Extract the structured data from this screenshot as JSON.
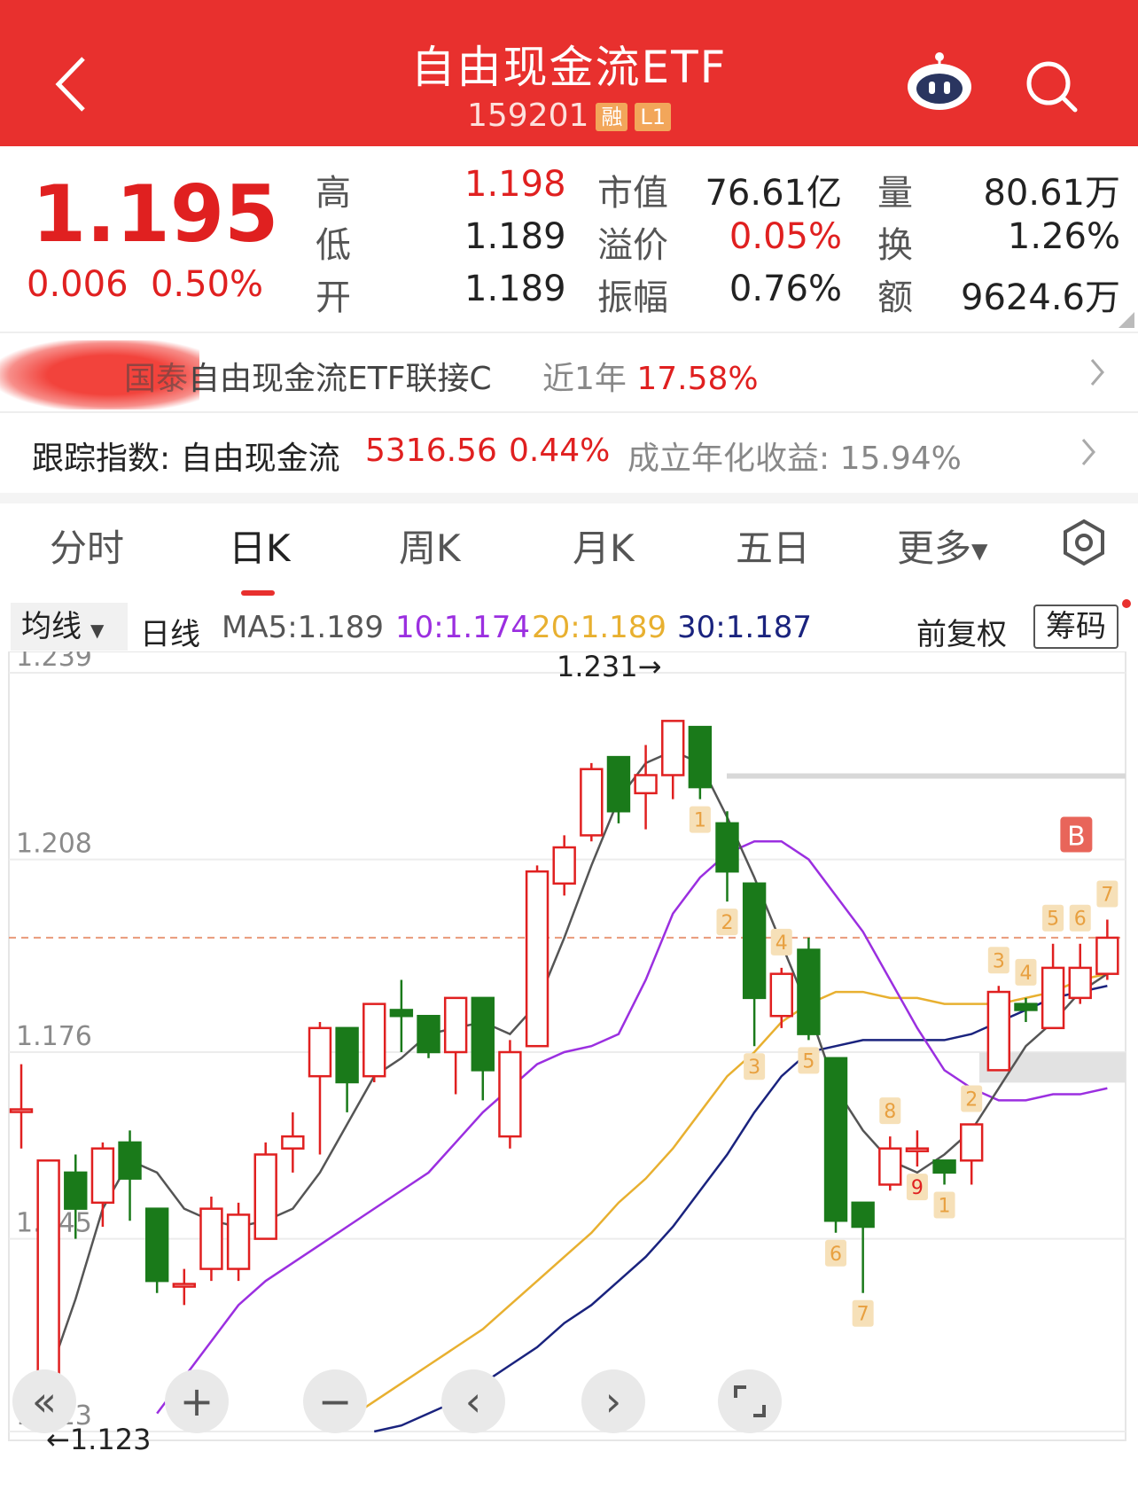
{
  "header": {
    "title": "自由现金流ETF",
    "code": "159201",
    "badge_margin": "融",
    "badge_level": "L1"
  },
  "quote": {
    "price": "1.195",
    "change": "0.006",
    "change_pct": "0.50%",
    "high_label": "高",
    "high": "1.198",
    "low_label": "低",
    "low": "1.189",
    "open_label": "开",
    "open": "1.189",
    "mcap_label": "市值",
    "mcap": "76.61亿",
    "premium_label": "溢价",
    "premium": "0.05%",
    "amp_label": "振幅",
    "amp": "0.76%",
    "vol_label": "量",
    "vol": "80.61万",
    "turn_label": "换",
    "turn": "1.26%",
    "amt_label": "额",
    "amt": "9624.6万"
  },
  "fund_link": {
    "name_partial": "国泰",
    "name": "自由现金流ETF联接C",
    "period_label": "近1年",
    "return": "17.58%"
  },
  "index_row": {
    "label": "跟踪指数: 自由现金流",
    "value": "5316.56",
    "pct": "0.44%",
    "annual_label": "成立年化收益: 15.94%"
  },
  "tabs": [
    "分时",
    "日K",
    "周K",
    "月K",
    "五日",
    "更多"
  ],
  "legend": {
    "ma_select": "均线",
    "period": "日线",
    "ma5": "MA5:1.189",
    "ma10": "10:1.174",
    "ma20": "20:1.189",
    "ma30": "30:1.187",
    "adjust": "前复权",
    "chips": "筹码"
  },
  "colors": {
    "up": "#e02020",
    "down": "#1a7a1a",
    "ma5": "#555555",
    "ma10": "#9b2fe0",
    "ma20": "#e8b030",
    "ma30": "#1a237e",
    "header": "#e8302e"
  },
  "chart_data": {
    "type": "candlestick",
    "y_ticks": [
      "1.239",
      "1.208",
      "1.176",
      "1.145",
      "1.113"
    ],
    "ylim": [
      1.113,
      1.239
    ],
    "current_price_line": 1.195,
    "max_label": "1.231→",
    "min_label": "←1.123",
    "buy_marker": "B",
    "candles": [
      {
        "o": 1.1665,
        "c": 1.1665,
        "h": 1.174,
        "l": 1.16
      },
      {
        "o": 1.12,
        "c": 1.158,
        "h": 1.158,
        "l": 1.117
      },
      {
        "o": 1.156,
        "c": 1.15,
        "h": 1.159,
        "l": 1.145
      },
      {
        "o": 1.151,
        "c": 1.16,
        "h": 1.161,
        "l": 1.147
      },
      {
        "o": 1.161,
        "c": 1.155,
        "h": 1.163,
        "l": 1.148
      },
      {
        "o": 1.15,
        "c": 1.138,
        "h": 1.15,
        "l": 1.136
      },
      {
        "o": 1.1375,
        "c": 1.1375,
        "h": 1.14,
        "l": 1.134
      },
      {
        "o": 1.14,
        "c": 1.15,
        "h": 1.152,
        "l": 1.138
      },
      {
        "o": 1.14,
        "c": 1.149,
        "h": 1.151,
        "l": 1.138
      },
      {
        "o": 1.145,
        "c": 1.159,
        "h": 1.161,
        "l": 1.145
      },
      {
        "o": 1.16,
        "c": 1.162,
        "h": 1.166,
        "l": 1.156
      },
      {
        "o": 1.172,
        "c": 1.18,
        "h": 1.181,
        "l": 1.159
      },
      {
        "o": 1.18,
        "c": 1.171,
        "h": 1.18,
        "l": 1.166
      },
      {
        "o": 1.172,
        "c": 1.184,
        "h": 1.184,
        "l": 1.171
      },
      {
        "o": 1.183,
        "c": 1.182,
        "h": 1.188,
        "l": 1.176
      },
      {
        "o": 1.182,
        "c": 1.176,
        "h": 1.182,
        "l": 1.175
      },
      {
        "o": 1.176,
        "c": 1.185,
        "h": 1.185,
        "l": 1.169
      },
      {
        "o": 1.185,
        "c": 1.173,
        "h": 1.185,
        "l": 1.168
      },
      {
        "o": 1.162,
        "c": 1.176,
        "h": 1.178,
        "l": 1.16
      },
      {
        "o": 1.177,
        "c": 1.206,
        "h": 1.207,
        "l": 1.177
      },
      {
        "o": 1.204,
        "c": 1.21,
        "h": 1.212,
        "l": 1.202
      },
      {
        "o": 1.212,
        "c": 1.223,
        "h": 1.224,
        "l": 1.211
      },
      {
        "o": 1.225,
        "c": 1.216,
        "h": 1.225,
        "l": 1.214
      },
      {
        "o": 1.219,
        "c": 1.222,
        "h": 1.227,
        "l": 1.213
      },
      {
        "o": 1.222,
        "c": 1.231,
        "h": 1.231,
        "l": 1.218
      },
      {
        "o": 1.23,
        "c": 1.22,
        "h": 1.23,
        "l": 1.218
      },
      {
        "o": 1.214,
        "c": 1.206,
        "h": 1.216,
        "l": 1.201
      },
      {
        "o": 1.204,
        "c": 1.185,
        "h": 1.204,
        "l": 1.177
      },
      {
        "o": 1.182,
        "c": 1.189,
        "h": 1.19,
        "l": 1.18
      },
      {
        "o": 1.193,
        "c": 1.179,
        "h": 1.195,
        "l": 1.178
      },
      {
        "o": 1.175,
        "c": 1.148,
        "h": 1.175,
        "l": 1.146
      },
      {
        "o": 1.151,
        "c": 1.147,
        "h": 1.151,
        "l": 1.136
      },
      {
        "o": 1.154,
        "c": 1.16,
        "h": 1.162,
        "l": 1.153
      },
      {
        "o": 1.16,
        "c": 1.16,
        "h": 1.163,
        "l": 1.157
      },
      {
        "o": 1.158,
        "c": 1.156,
        "h": 1.158,
        "l": 1.154
      },
      {
        "o": 1.158,
        "c": 1.164,
        "h": 1.164,
        "l": 1.154
      },
      {
        "o": 1.173,
        "c": 1.186,
        "h": 1.187,
        "l": 1.173
      },
      {
        "o": 1.184,
        "c": 1.183,
        "h": 1.185,
        "l": 1.181
      },
      {
        "o": 1.18,
        "c": 1.19,
        "h": 1.194,
        "l": 1.18
      },
      {
        "o": 1.185,
        "c": 1.19,
        "h": 1.194,
        "l": 1.184
      },
      {
        "o": 1.189,
        "c": 1.195,
        "h": 1.198,
        "l": 1.188
      }
    ],
    "ma5": [
      1.122,
      1.135,
      1.15,
      1.158,
      1.156,
      1.15,
      1.148,
      1.147,
      1.148,
      1.15,
      1.156,
      1.164,
      1.172,
      1.175,
      1.179,
      1.18,
      1.181,
      1.179,
      1.184,
      1.195,
      1.207,
      1.218,
      1.224,
      1.226,
      1.224,
      1.215,
      1.205,
      1.194,
      1.183,
      1.17,
      1.163,
      1.158,
      1.156,
      1.159,
      1.163,
      1.17,
      1.177,
      1.181,
      1.186,
      1.189
    ],
    "ma10": [
      1.116,
      1.122,
      1.128,
      1.134,
      1.138,
      1.141,
      1.144,
      1.147,
      1.15,
      1.153,
      1.156,
      1.161,
      1.166,
      1.17,
      1.174,
      1.176,
      1.177,
      1.179,
      1.188,
      1.199,
      1.205,
      1.209,
      1.211,
      1.211,
      1.208,
      1.202,
      1.196,
      1.188,
      1.18,
      1.173,
      1.17,
      1.168,
      1.168,
      1.169,
      1.169,
      1.17
    ],
    "ma20": [
      1.115,
      1.118,
      1.121,
      1.124,
      1.127,
      1.13,
      1.134,
      1.138,
      1.142,
      1.146,
      1.151,
      1.155,
      1.16,
      1.166,
      1.172,
      1.176,
      1.181,
      1.184,
      1.186,
      1.186,
      1.185,
      1.185,
      1.184,
      1.184,
      1.184,
      1.185,
      1.186,
      1.188,
      1.189
    ],
    "ma30": [
      1.113,
      1.114,
      1.116,
      1.118,
      1.121,
      1.124,
      1.127,
      1.131,
      1.134,
      1.138,
      1.142,
      1.147,
      1.153,
      1.159,
      1.166,
      1.172,
      1.176,
      1.177,
      1.178,
      1.178,
      1.178,
      1.178,
      1.179,
      1.181,
      1.183,
      1.185,
      1.186,
      1.187
    ],
    "counters": [
      {
        "i": 25,
        "n": "1"
      },
      {
        "i": 26,
        "n": "2"
      },
      {
        "i": 27,
        "n": "3"
      },
      {
        "i": 28,
        "n": "4"
      },
      {
        "i": 29,
        "n": "5"
      },
      {
        "i": 30,
        "n": "6"
      },
      {
        "i": 31,
        "n": "7"
      },
      {
        "i": 32,
        "n": "8"
      },
      {
        "i": 33,
        "n": "9",
        "red": true
      },
      {
        "i": 34,
        "n": "1"
      },
      {
        "i": 35,
        "n": "2"
      },
      {
        "i": 36,
        "n": "3"
      },
      {
        "i": 37,
        "n": "4"
      },
      {
        "i": 38,
        "n": "5"
      },
      {
        "i": 39,
        "n": "6"
      },
      {
        "i": 40,
        "n": "7"
      }
    ]
  }
}
